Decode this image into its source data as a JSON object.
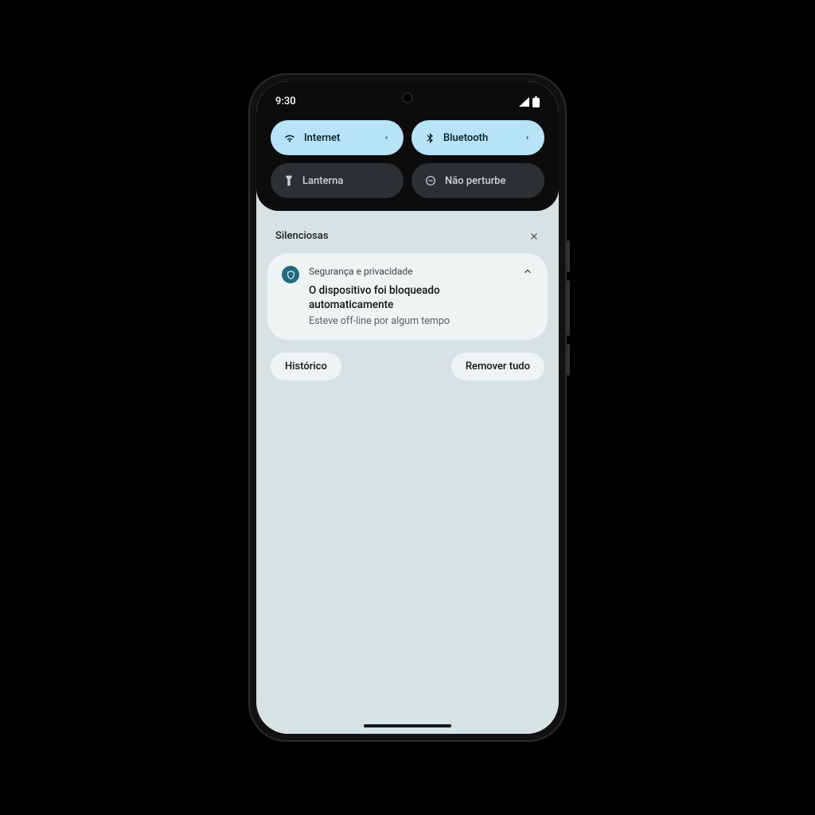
{
  "status": {
    "time": "9:30"
  },
  "quick_settings": {
    "tiles": [
      {
        "label": "Internet",
        "active": true
      },
      {
        "label": "Bluetooth",
        "active": true
      },
      {
        "label": "Lanterna",
        "active": false
      },
      {
        "label": "Não perturbe",
        "active": false
      }
    ]
  },
  "section": {
    "title": "Silenciosas"
  },
  "notification": {
    "app": "Segurança e privacidade",
    "title": "O dispositivo foi bloqueado automaticamente",
    "subtitle": "Esteve off-line por algum tempo"
  },
  "actions": {
    "history": "Histórico",
    "clear_all": "Remover tudo"
  }
}
